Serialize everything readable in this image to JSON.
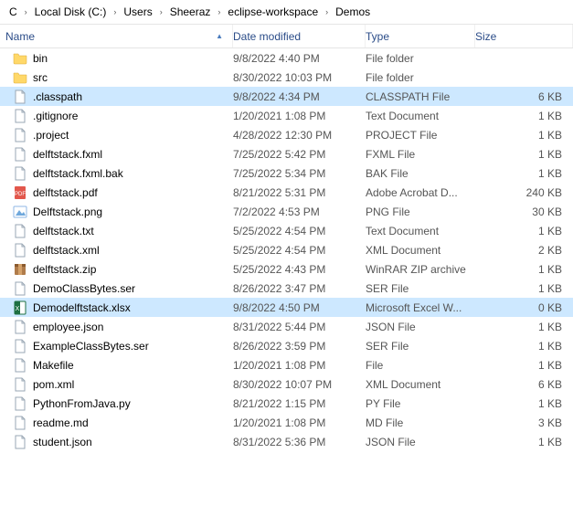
{
  "breadcrumb": [
    "C",
    "Local Disk (C:)",
    "Users",
    "Sheeraz",
    "eclipse-workspace",
    "Demos"
  ],
  "columns": {
    "name": "Name",
    "date": "Date modified",
    "type": "Type",
    "size": "Size"
  },
  "files": [
    {
      "icon": "folder",
      "name": "bin",
      "date": "9/8/2022 4:40 PM",
      "type": "File folder",
      "size": "",
      "selected": false
    },
    {
      "icon": "folder",
      "name": "src",
      "date": "8/30/2022 10:03 PM",
      "type": "File folder",
      "size": "",
      "selected": false
    },
    {
      "icon": "file",
      "name": ".classpath",
      "date": "9/8/2022 4:34 PM",
      "type": "CLASSPATH File",
      "size": "6 KB",
      "selected": true
    },
    {
      "icon": "file",
      "name": ".gitignore",
      "date": "1/20/2021 1:08 PM",
      "type": "Text Document",
      "size": "1 KB",
      "selected": false
    },
    {
      "icon": "file",
      "name": ".project",
      "date": "4/28/2022 12:30 PM",
      "type": "PROJECT File",
      "size": "1 KB",
      "selected": false
    },
    {
      "icon": "file",
      "name": "delftstack.fxml",
      "date": "7/25/2022 5:42 PM",
      "type": "FXML File",
      "size": "1 KB",
      "selected": false
    },
    {
      "icon": "file",
      "name": "delftstack.fxml.bak",
      "date": "7/25/2022 5:34 PM",
      "type": "BAK File",
      "size": "1 KB",
      "selected": false
    },
    {
      "icon": "pdf",
      "name": "delftstack.pdf",
      "date": "8/21/2022 5:31 PM",
      "type": "Adobe Acrobat D...",
      "size": "240 KB",
      "selected": false
    },
    {
      "icon": "image",
      "name": "Delftstack.png",
      "date": "7/2/2022 4:53 PM",
      "type": "PNG File",
      "size": "30 KB",
      "selected": false
    },
    {
      "icon": "file",
      "name": "delftstack.txt",
      "date": "5/25/2022 4:54 PM",
      "type": "Text Document",
      "size": "1 KB",
      "selected": false
    },
    {
      "icon": "file",
      "name": "delftstack.xml",
      "date": "5/25/2022 4:54 PM",
      "type": "XML Document",
      "size": "2 KB",
      "selected": false
    },
    {
      "icon": "archive",
      "name": "delftstack.zip",
      "date": "5/25/2022 4:43 PM",
      "type": "WinRAR ZIP archive",
      "size": "1 KB",
      "selected": false
    },
    {
      "icon": "file",
      "name": "DemoClassBytes.ser",
      "date": "8/26/2022 3:47 PM",
      "type": "SER File",
      "size": "1 KB",
      "selected": false
    },
    {
      "icon": "excel",
      "name": "Demodelftstack.xlsx",
      "date": "9/8/2022 4:50 PM",
      "type": "Microsoft Excel W...",
      "size": "0 KB",
      "selected": true
    },
    {
      "icon": "file",
      "name": "employee.json",
      "date": "8/31/2022 5:44 PM",
      "type": "JSON File",
      "size": "1 KB",
      "selected": false
    },
    {
      "icon": "file",
      "name": "ExampleClassBytes.ser",
      "date": "8/26/2022 3:59 PM",
      "type": "SER File",
      "size": "1 KB",
      "selected": false
    },
    {
      "icon": "file",
      "name": "Makefile",
      "date": "1/20/2021 1:08 PM",
      "type": "File",
      "size": "1 KB",
      "selected": false
    },
    {
      "icon": "file",
      "name": "pom.xml",
      "date": "8/30/2022 10:07 PM",
      "type": "XML Document",
      "size": "6 KB",
      "selected": false
    },
    {
      "icon": "file",
      "name": "PythonFromJava.py",
      "date": "8/21/2022 1:15 PM",
      "type": "PY File",
      "size": "1 KB",
      "selected": false
    },
    {
      "icon": "file",
      "name": "readme.md",
      "date": "1/20/2021 1:08 PM",
      "type": "MD File",
      "size": "3 KB",
      "selected": false
    },
    {
      "icon": "file",
      "name": "student.json",
      "date": "8/31/2022 5:36 PM",
      "type": "JSON File",
      "size": "1 KB",
      "selected": false
    }
  ]
}
